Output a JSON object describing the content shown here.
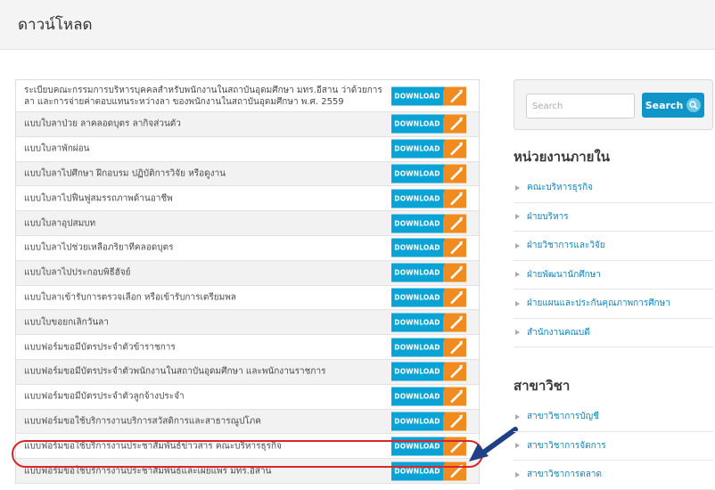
{
  "header": {
    "title": "ดาวน์โหลด"
  },
  "download_label": "DOWNLOAD",
  "downloads": [
    "ระเบียบคณะกรรมการบริหารบุคคลสำหรับพนักงานในสถาบันอุดมศึกษา มทร.อีสาน ว่าด้วยการลา และการจ่ายค่าตอบแทนระหว่างลา ของพนักงานในสถาบันอุดมศึกษา พ.ศ. 2559",
    "แบบใบลาป่วย ลาคลอดบุตร ลากิจส่วนตัว",
    "แบบใบลาพักผ่อน",
    "แบบใบลาไปศึกษา ฝึกอบรม ปฏิบัติการวิจัย หรือดูงาน",
    "แบบใบลาไปฟื้นฟูสมรรถภาพด้านอาชีพ",
    "แบบใบลาอุปสมบท",
    "แบบใบลาไปช่วยเหลือภริยาที่คลอดบุตร",
    "แบบใบลาไปประกอบพิธีฮัจย์",
    "แบบใบลาเข้ารับการตรวจเลือก หรือเข้ารับการเตรียมพล",
    "แบบใบขอยกเลิกวันลา",
    "แบบฟอร์มขอมีบัตรประจำตัวข้าราชการ",
    "แบบฟอร์มขอมีบัตรประจำตัวพนักงานในสถาบันอุดมศึกษา และพนักงานราชการ",
    "แบบฟอร์มขอมีบัตรประจำตัวลูกจ้างประจำ",
    "แบบฟอร์มขอใช้บริการงานบริการสวัสดิการและสาธารณูปโภค",
    "แบบฟอร์มขอใช้บริการงานประชาสัมพันธ์ข่าวสาร คณะบริหารธุรกิจ",
    "แบบฟอร์มขอใช้บริการงานประชาสัมพันธ์และเผยแพร่ มทร.อีสาน"
  ],
  "search": {
    "placeholder": "Search",
    "button_label": "Search"
  },
  "sidebar": {
    "internal_heading": "หน่วยงานภายใน",
    "internal_items": [
      "คณะบริหารธุรกิจ",
      "ฝ่ายบริหาร",
      "ฝ่ายวิชาการและวิจัย",
      "ฝ่ายพัฒนานักศึกษา",
      "ฝ่ายแผนและประกันคุณภาพการศึกษา",
      "สำนักงานคณบดี"
    ],
    "major_heading": "สาขาวิชา",
    "major_items": [
      "สาขาวิชาการบัญชี",
      "สาขาวิชาการจัดการ",
      "สาขาวิชาการตลาด"
    ]
  },
  "colors": {
    "download_blue": "#0aa3d6",
    "download_orange": "#f08c1f",
    "highlight_red": "#d9262c",
    "pointer_navy": "#1f3f86",
    "link_blue": "#0f85c0"
  },
  "icons": {
    "download_arrow": "pencil-arrow-icon",
    "search": "search-icon",
    "list_bullet": "triangle-right-icon",
    "pointer": "pointer-arrow-icon"
  }
}
